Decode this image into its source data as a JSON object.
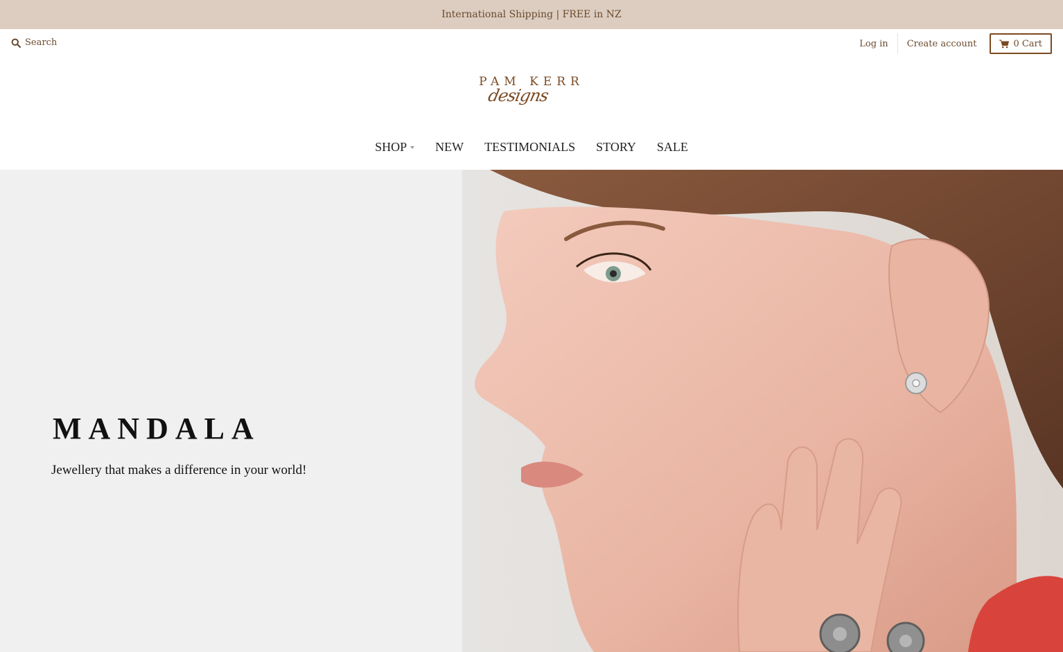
{
  "announcement": {
    "text": "International Shipping | FREE in NZ"
  },
  "header": {
    "search_label": "Search",
    "login_label": "Log in",
    "create_account_label": "Create account",
    "cart_label": "0 Cart"
  },
  "logo": {
    "line1": "PAM KERR",
    "line2": "designs"
  },
  "nav": {
    "items": [
      {
        "label": "SHOP",
        "has_dropdown": true
      },
      {
        "label": "NEW"
      },
      {
        "label": "TESTIMONIALS"
      },
      {
        "label": "STORY"
      },
      {
        "label": "SALE"
      }
    ]
  },
  "hero": {
    "title": "MANDALA",
    "subtitle": "Jewellery that makes a difference in your world!"
  },
  "colors": {
    "announcement_bg": "#dccdc0",
    "brand_brown": "#7a4a22",
    "hero_left_bg": "#f0f0f0"
  }
}
